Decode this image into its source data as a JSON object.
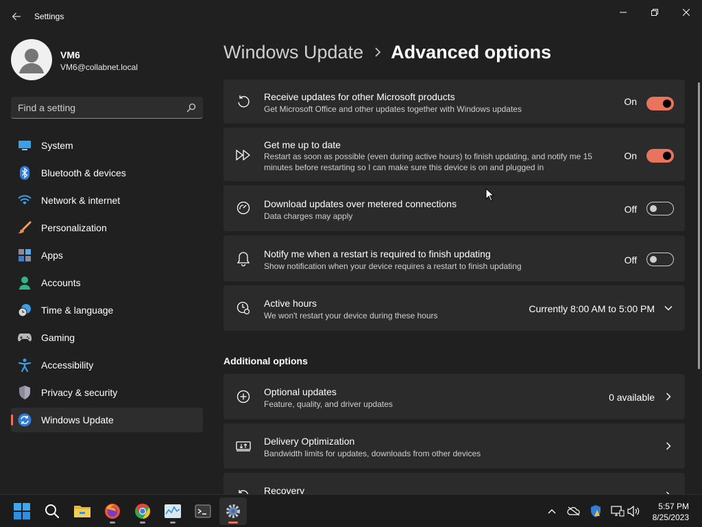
{
  "window": {
    "app_title": "Settings"
  },
  "profile": {
    "name": "VM6",
    "email": "VM6@collabnet.local"
  },
  "search": {
    "placeholder": "Find a setting"
  },
  "nav": {
    "items": [
      {
        "label": "System",
        "icon": "system-icon",
        "active": false
      },
      {
        "label": "Bluetooth & devices",
        "icon": "bluetooth-icon",
        "active": false
      },
      {
        "label": "Network & internet",
        "icon": "wifi-icon",
        "active": false
      },
      {
        "label": "Personalization",
        "icon": "brush-icon",
        "active": false
      },
      {
        "label": "Apps",
        "icon": "apps-icon",
        "active": false
      },
      {
        "label": "Accounts",
        "icon": "person-icon",
        "active": false
      },
      {
        "label": "Time & language",
        "icon": "clock-globe-icon",
        "active": false
      },
      {
        "label": "Gaming",
        "icon": "gamepad-icon",
        "active": false
      },
      {
        "label": "Accessibility",
        "icon": "accessibility-icon",
        "active": false
      },
      {
        "label": "Privacy & security",
        "icon": "shield-icon",
        "active": false
      },
      {
        "label": "Windows Update",
        "icon": "update-icon",
        "active": true
      }
    ]
  },
  "breadcrumb": {
    "parent": "Windows Update",
    "current": "Advanced options"
  },
  "settings": [
    {
      "title": "Receive updates for other Microsoft products",
      "desc": "Get Microsoft Office and other updates together with Windows updates",
      "state": "On",
      "enabled": true
    },
    {
      "title": "Get me up to date",
      "desc": "Restart as soon as possible (even during active hours) to finish updating, and notify me 15 minutes before restarting so I can make sure this device is on and plugged in",
      "state": "On",
      "enabled": true
    },
    {
      "title": "Download updates over metered connections",
      "desc": "Data charges may apply",
      "state": "Off",
      "enabled": false
    },
    {
      "title": "Notify me when a restart is required to finish updating",
      "desc": "Show notification when your device requires a restart to finish updating",
      "state": "Off",
      "enabled": false
    },
    {
      "title": "Active hours",
      "desc": "We won't restart your device during these hours",
      "value": "Currently 8:00 AM to 5:00 PM"
    }
  ],
  "additional": {
    "title": "Additional options",
    "items": [
      {
        "title": "Optional updates",
        "desc": "Feature, quality, and driver updates",
        "value": "0 available"
      },
      {
        "title": "Delivery Optimization",
        "desc": "Bandwidth limits for updates, downloads from other devices"
      },
      {
        "title": "Recovery",
        "desc": ""
      }
    ]
  },
  "taskbar": {
    "apps": [
      "start-icon",
      "search-icon",
      "file-explorer-icon",
      "firefox-icon",
      "chrome-icon",
      "task-manager-icon",
      "terminal-icon",
      "settings-icon"
    ],
    "clock": {
      "time": "5:57 PM",
      "date": "8/25/2023"
    }
  },
  "colors": {
    "accent": "#e8735e",
    "background": "#202020",
    "card": "#2b2b2b"
  }
}
